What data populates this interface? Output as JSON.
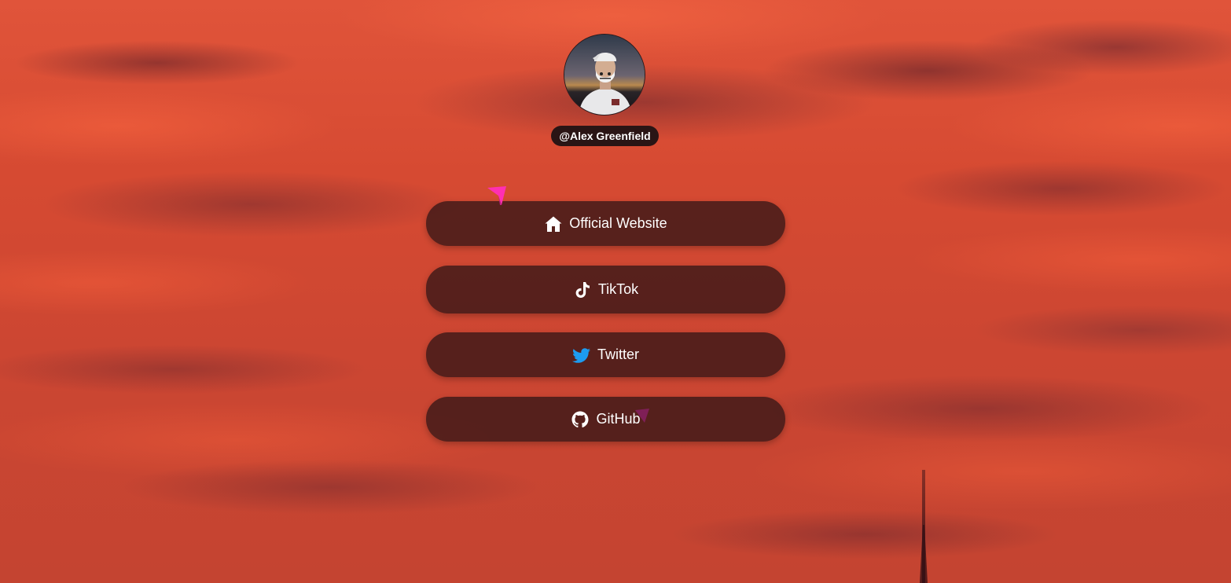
{
  "profile": {
    "handle": "@Alex Greenfield"
  },
  "links": [
    {
      "label": "Official Website",
      "icon": "home-icon"
    },
    {
      "label": "TikTok",
      "icon": "tiktok-icon"
    },
    {
      "label": "Twitter",
      "icon": "twitter-icon"
    },
    {
      "label": "GitHub",
      "icon": "github-icon"
    }
  ],
  "colors": {
    "background_sky": "#d84a2c",
    "button_bg": "#34161699",
    "handle_bg": "#2a1515",
    "text": "#ffffff",
    "twitter_blue": "#1d9bf0",
    "cursor_pink": "#ff2fb3"
  }
}
